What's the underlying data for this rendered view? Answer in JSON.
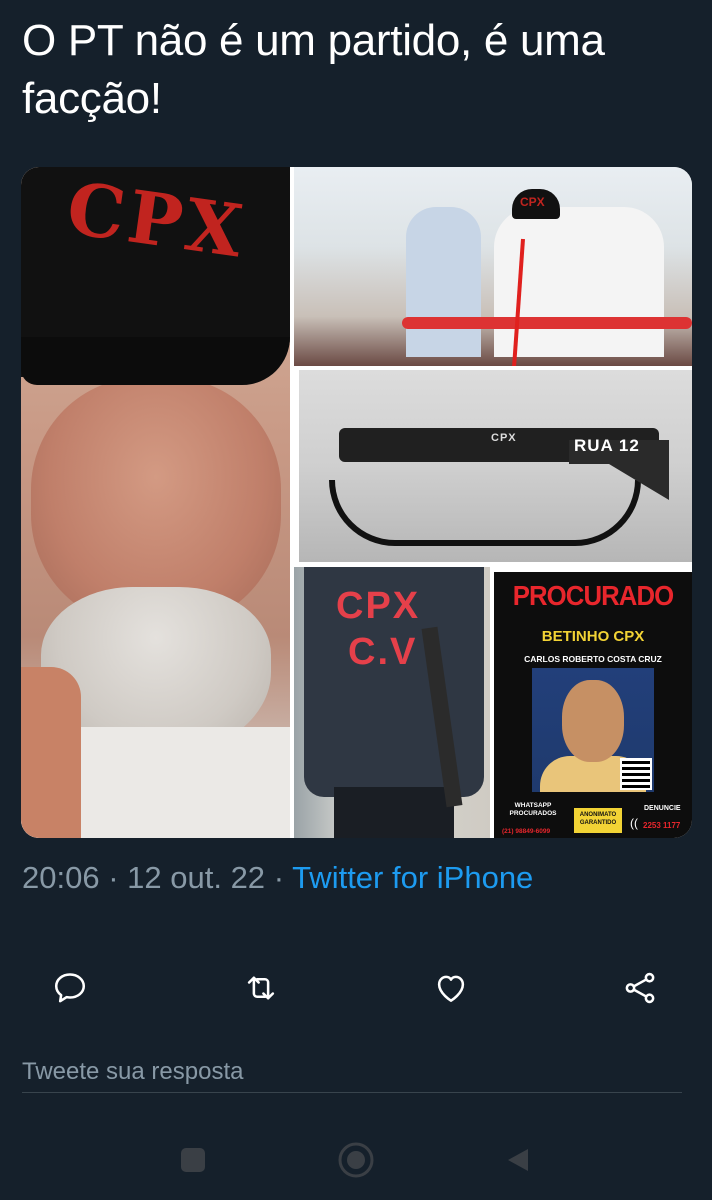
{
  "tweet": {
    "text": "O PT não é um partido, é uma facção!",
    "time": "20:06",
    "date": "12 out. 22",
    "separator": "·",
    "source": "Twitter for iPhone"
  },
  "media": {
    "cap_text": "CPX",
    "rifle_tag": "CPX",
    "rifle_label": "RUA 12",
    "shirt_line1": "CPX",
    "shirt_line2": "C.V",
    "poster": {
      "title": "PROCURADO",
      "alias": "BETINHO CPX",
      "full_name": "CARLOS ROBERTO COSTA CRUZ",
      "whatsapp_label": "WHATSAPP PROCURADOS",
      "whatsapp_number": "(21) 98849-6099",
      "anon_label": "ANONIMATO GARANTIDO",
      "denounce_label": "DENUNCIE",
      "denounce_number": "2253 1177"
    }
  },
  "actions": {
    "reply_icon": "reply-bubble-icon",
    "retweet_icon": "retweet-icon",
    "like_icon": "heart-icon",
    "share_icon": "share-icon"
  },
  "reply": {
    "placeholder": "Tweete sua resposta"
  },
  "navbar": {
    "recents_icon": "square-icon",
    "home_icon": "circle-icon",
    "back_icon": "triangle-back-icon"
  },
  "colors": {
    "background": "#15202b",
    "text": "#ffffff",
    "muted": "#8899a6",
    "link": "#1d9bf0"
  }
}
